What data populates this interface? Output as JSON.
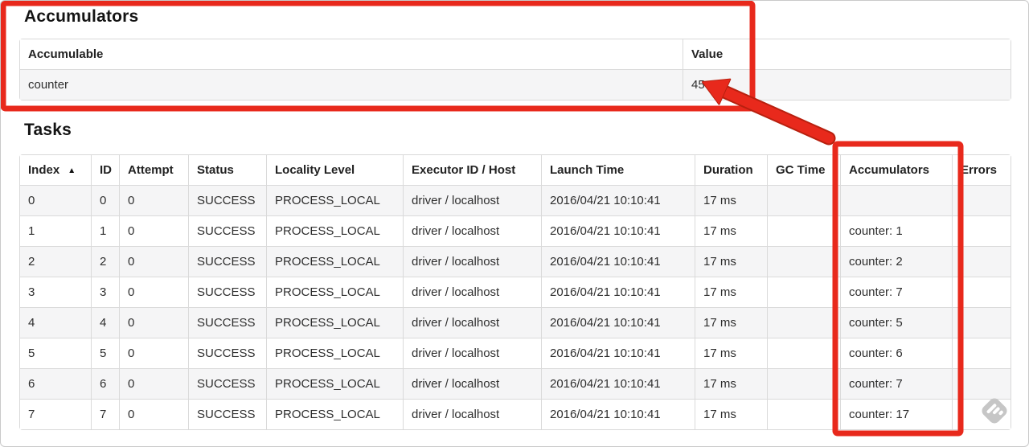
{
  "annotations": {
    "color": "#e8291c",
    "color_dark": "#b8200f"
  },
  "watermark": {
    "icon": "skitch-watermark",
    "color": "#c6c6c6"
  },
  "accumulators_section": {
    "heading": "Accumulators",
    "table": {
      "headers": {
        "accumulable": "Accumulable",
        "value": "Value"
      },
      "rows": [
        {
          "accumulable": "counter",
          "value": "45"
        }
      ]
    }
  },
  "tasks_section": {
    "heading": "Tasks",
    "table": {
      "headers": {
        "index": "Index",
        "id": "ID",
        "attempt": "Attempt",
        "status": "Status",
        "locality": "Locality Level",
        "executor": "Executor ID / Host",
        "launch": "Launch Time",
        "duration": "Duration",
        "gc": "GC Time",
        "accumulators": "Accumulators",
        "errors": "Errors"
      },
      "sort_icon": "▲",
      "rows": [
        {
          "index": "0",
          "id": "0",
          "attempt": "0",
          "status": "SUCCESS",
          "locality": "PROCESS_LOCAL",
          "executor": "driver / localhost",
          "launch": "2016/04/21 10:10:41",
          "duration": "17 ms",
          "gc": "",
          "accumulators": "",
          "errors": ""
        },
        {
          "index": "1",
          "id": "1",
          "attempt": "0",
          "status": "SUCCESS",
          "locality": "PROCESS_LOCAL",
          "executor": "driver / localhost",
          "launch": "2016/04/21 10:10:41",
          "duration": "17 ms",
          "gc": "",
          "accumulators": "counter: 1",
          "errors": ""
        },
        {
          "index": "2",
          "id": "2",
          "attempt": "0",
          "status": "SUCCESS",
          "locality": "PROCESS_LOCAL",
          "executor": "driver / localhost",
          "launch": "2016/04/21 10:10:41",
          "duration": "17 ms",
          "gc": "",
          "accumulators": "counter: 2",
          "errors": ""
        },
        {
          "index": "3",
          "id": "3",
          "attempt": "0",
          "status": "SUCCESS",
          "locality": "PROCESS_LOCAL",
          "executor": "driver / localhost",
          "launch": "2016/04/21 10:10:41",
          "duration": "17 ms",
          "gc": "",
          "accumulators": "counter: 7",
          "errors": ""
        },
        {
          "index": "4",
          "id": "4",
          "attempt": "0",
          "status": "SUCCESS",
          "locality": "PROCESS_LOCAL",
          "executor": "driver / localhost",
          "launch": "2016/04/21 10:10:41",
          "duration": "17 ms",
          "gc": "",
          "accumulators": "counter: 5",
          "errors": ""
        },
        {
          "index": "5",
          "id": "5",
          "attempt": "0",
          "status": "SUCCESS",
          "locality": "PROCESS_LOCAL",
          "executor": "driver / localhost",
          "launch": "2016/04/21 10:10:41",
          "duration": "17 ms",
          "gc": "",
          "accumulators": "counter: 6",
          "errors": ""
        },
        {
          "index": "6",
          "id": "6",
          "attempt": "0",
          "status": "SUCCESS",
          "locality": "PROCESS_LOCAL",
          "executor": "driver / localhost",
          "launch": "2016/04/21 10:10:41",
          "duration": "17 ms",
          "gc": "",
          "accumulators": "counter: 7",
          "errors": ""
        },
        {
          "index": "7",
          "id": "7",
          "attempt": "0",
          "status": "SUCCESS",
          "locality": "PROCESS_LOCAL",
          "executor": "driver / localhost",
          "launch": "2016/04/21 10:10:41",
          "duration": "17 ms",
          "gc": "",
          "accumulators": "counter: 17",
          "errors": ""
        }
      ]
    }
  }
}
